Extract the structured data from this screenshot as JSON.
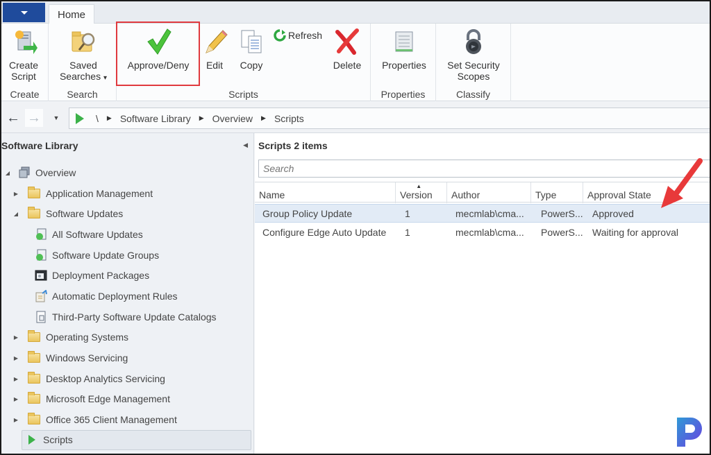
{
  "app_menu": {
    "icon": "caret-down-icon"
  },
  "tabs": [
    {
      "label": "Home",
      "active": true
    }
  ],
  "ribbon": {
    "groups": [
      {
        "name": "Create",
        "buttons": [
          {
            "label_line1": "Create",
            "label_line2": "Script",
            "icon": "create-script-icon"
          }
        ]
      },
      {
        "name": "Search",
        "buttons": [
          {
            "label_line1": "Saved",
            "label_line2": "Searches",
            "icon": "saved-searches-icon",
            "has_dropdown": true
          }
        ]
      },
      {
        "name": "Scripts",
        "buttons": [
          {
            "label": "Approve/Deny",
            "icon": "checkmark-icon",
            "highlighted": true
          },
          {
            "label": "Edit",
            "icon": "pencil-icon"
          },
          {
            "label": "Copy",
            "icon": "copy-icon"
          },
          {
            "label": "Refresh",
            "icon": "refresh-icon"
          },
          {
            "label": "Delete",
            "icon": "delete-x-icon"
          }
        ]
      },
      {
        "name": "Properties",
        "buttons": [
          {
            "label": "Properties",
            "icon": "properties-icon"
          }
        ]
      },
      {
        "name": "Classify",
        "buttons": [
          {
            "label_line1": "Set Security",
            "label_line2": "Scopes",
            "icon": "padlock-icon"
          }
        ]
      }
    ],
    "dropdown_glyph": "▾"
  },
  "navbar": {
    "back_icon": "back-arrow-icon",
    "forward_icon": "forward-arrow-icon",
    "history_icon": "dropdown-icon",
    "breadcrumb": [
      "\\",
      "Software Library",
      "Overview",
      "Scripts"
    ],
    "separator": "▶"
  },
  "leftpane": {
    "title": "Software Library",
    "collapse_glyph": "◀",
    "tree": [
      {
        "label": "Overview",
        "level": 0,
        "expanded": true,
        "icon": "overview-icon"
      },
      {
        "label": "Application Management",
        "level": 1,
        "expanded": false,
        "icon": "folder-icon"
      },
      {
        "label": "Software Updates",
        "level": 1,
        "expanded": true,
        "icon": "folder-icon"
      },
      {
        "label": "All Software Updates",
        "level": 2,
        "icon": "software-updates-icon"
      },
      {
        "label": "Software Update Groups",
        "level": 2,
        "icon": "update-groups-icon"
      },
      {
        "label": "Deployment Packages",
        "level": 2,
        "icon": "deployment-packages-icon"
      },
      {
        "label": "Automatic Deployment Rules",
        "level": 2,
        "icon": "deployment-rules-icon"
      },
      {
        "label": "Third-Party Software Update Catalogs",
        "level": 2,
        "icon": "catalog-icon"
      },
      {
        "label": "Operating Systems",
        "level": 1,
        "expanded": false,
        "icon": "folder-icon"
      },
      {
        "label": "Windows Servicing",
        "level": 1,
        "expanded": false,
        "icon": "folder-icon"
      },
      {
        "label": "Desktop Analytics Servicing",
        "level": 1,
        "expanded": false,
        "icon": "folder-icon"
      },
      {
        "label": "Microsoft Edge Management",
        "level": 1,
        "expanded": false,
        "icon": "folder-icon"
      },
      {
        "label": "Office 365 Client Management",
        "level": 1,
        "expanded": false,
        "icon": "folder-icon"
      },
      {
        "label": "Scripts",
        "level": 1,
        "selected": true,
        "icon": "scripts-play-icon"
      }
    ],
    "twisty_expanded": "◢",
    "twisty_collapsed": "▶"
  },
  "results": {
    "title": "Scripts 2 items",
    "search_placeholder": "Search",
    "sort_glyph": "▲",
    "columns": [
      "Name",
      "Version",
      "Author",
      "Type",
      "Approval State"
    ],
    "rows": [
      {
        "name": "Group Policy Update",
        "version": "1",
        "author": "mecmlab\\cma...",
        "type": "PowerS...",
        "approval_state": "Approved",
        "selected": true
      },
      {
        "name": "Configure Edge Auto Update",
        "version": "1",
        "author": "mecmlab\\cma...",
        "type": "PowerS...",
        "approval_state": "Waiting for approval",
        "selected": false
      }
    ]
  },
  "annotation": {
    "arrow_color": "#e8393a",
    "highlight_color": "#e0393e"
  },
  "watermark": {
    "letter": "P"
  }
}
